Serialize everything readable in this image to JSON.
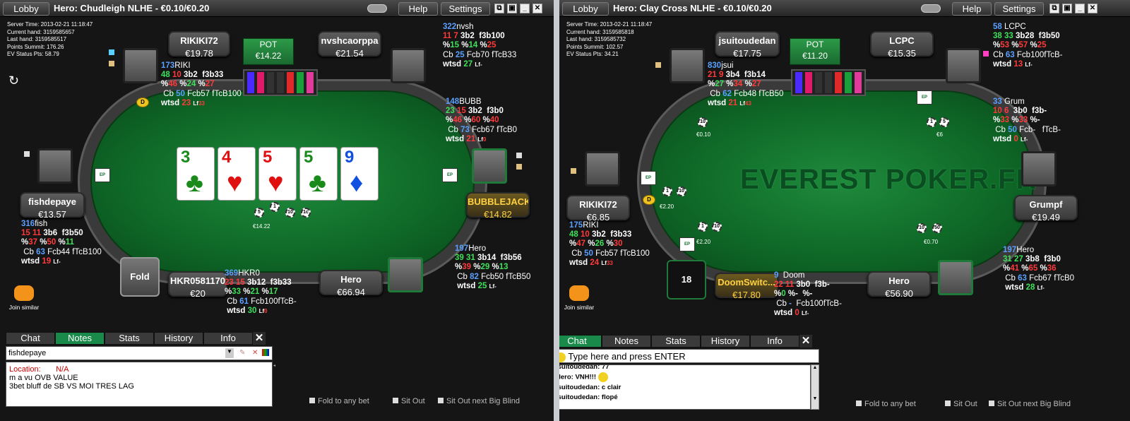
{
  "win1": {
    "lobby": "Lobby",
    "title": "Hero: Chudleigh NLHE - €0.10/€0.20",
    "help": "Help",
    "settings": "Settings",
    "info": [
      "Server Time: 2013-02-21 11:18:47",
      "Current hand: 3159585657",
      "Last hand: 3159585517",
      "Points Summit: 176.26",
      "EV Status Pts: 58.79"
    ],
    "pot_label": "POT",
    "pot": "€14.22",
    "seats": {
      "s1": {
        "name": "RIKIKI72",
        "stack": "€19.78"
      },
      "s2": {
        "name": "nvshcaorppa",
        "stack": "€21.54"
      },
      "s3": {
        "name": "fishdepaye",
        "stack": "€13.57"
      },
      "s4": {
        "name": "BUBBLEJACK",
        "stack": "€14.82"
      },
      "s5": {
        "name": "HKR0581170",
        "stack": "€20"
      },
      "s6": {
        "name": "Hero",
        "stack": "€66.94"
      }
    },
    "hud": {
      "h1": {
        "a": "173",
        "b": "RIKI",
        "l2": [
          "48",
          "10",
          "3b2",
          "f3b33"
        ],
        "l3": [
          "%",
          "46",
          "%",
          "24",
          "%",
          "27"
        ],
        "l4": [
          "Cb",
          "50",
          "Fcb57 fTcB100"
        ],
        "l5": [
          "wtsd",
          "23",
          "Lf",
          "33"
        ]
      },
      "h2": {
        "a": "322",
        "b": "nvsh",
        "l2": [
          "11",
          "7",
          "3b2",
          "f3b100"
        ],
        "l3": [
          "%",
          "15",
          "%",
          "14",
          "%",
          "25"
        ],
        "l4": [
          "Cb",
          "25",
          "Fcb70 fTcB33"
        ],
        "l5": [
          "wtsd",
          "27",
          "Lf",
          "-"
        ]
      },
      "h3": {
        "a": "148",
        "b": "BUBB",
        "l2": [
          "23",
          "15",
          "3b2",
          "f3b0"
        ],
        "l3": [
          "%",
          "46",
          "%",
          "60",
          "%",
          "40"
        ],
        "l4": [
          "Cb",
          "73",
          "Fcb67 fTcB0"
        ],
        "l5": [
          "wtsd",
          "21",
          "Lf",
          "0"
        ]
      },
      "h4": {
        "a": "316",
        "b": "fish",
        "l2": [
          "15",
          "11",
          "3b6",
          "f3b50"
        ],
        "l3": [
          "%",
          "37",
          "%",
          "50",
          "%",
          "11"
        ],
        "l4": [
          "Cb",
          "63",
          "Fcb44 fTcB100"
        ],
        "l5": [
          "wtsd",
          "19",
          "Lf",
          "-"
        ]
      },
      "h5": {
        "a": "369",
        "b": "HKR0",
        "l2": [
          "23",
          "15",
          "3b12",
          "f3b33"
        ],
        "l3": [
          "%",
          "33",
          "%",
          "21",
          "%",
          "17"
        ],
        "l4": [
          "Cb",
          "61",
          "Fcb100fTcB-"
        ],
        "l5": [
          "wtsd",
          "30",
          "Lf",
          "0"
        ]
      },
      "h6": {
        "a": "197",
        "b": "Hero",
        "l2": [
          "39",
          "31",
          "3b14",
          "f3b56"
        ],
        "l3": [
          "%",
          "39",
          "%",
          "29",
          "%",
          "13"
        ],
        "l4": [
          "Cb",
          "82",
          "Fcb50 fTcB50"
        ],
        "l5": [
          "wtsd",
          "25",
          "Lf",
          "-"
        ]
      }
    },
    "board": [
      {
        "r": "3",
        "s": "♣",
        "c": "blk"
      },
      {
        "r": "4",
        "s": "♥",
        "c": "red"
      },
      {
        "r": "5",
        "s": "♥",
        "c": "red"
      },
      {
        "r": "5",
        "s": "♣",
        "c": "blk"
      },
      {
        "r": "9",
        "s": "♦",
        "c": "blu"
      }
    ],
    "chips": [
      "5",
      "1",
      "10",
      "1c"
    ],
    "chip_total": "€14.22",
    "fold": "Fold",
    "join": "Join similar",
    "tabs": [
      "Chat",
      "Notes",
      "Stats",
      "History",
      "Info"
    ],
    "close": "✕",
    "notes_player": "fishdepaye",
    "notes": {
      "loc_label": "Location:",
      "loc_val": "N/A",
      "line1": "m a vu OVB VALUE",
      "line2": "3bet bluff de SB VS MOI TRES LAG"
    },
    "opts": [
      "Fold to any bet",
      "Sit Out",
      "Sit Out next Big Blind"
    ]
  },
  "win2": {
    "lobby": "Lobby",
    "title": "Hero: Clay Cross NLHE - €0.10/€0.20",
    "help": "Help",
    "settings": "Settings",
    "info": [
      "Server Time: 2013-02-21 11:18:47",
      "Current hand: 3159585818",
      "Last hand: 3159585732",
      "Points Summit: 102.57",
      "EV Status Pts: 34.21"
    ],
    "pot_label": "POT",
    "pot": "€11.20",
    "seats": {
      "s1": {
        "name": "jsuitoudedan",
        "stack": "€17.75"
      },
      "s2": {
        "name": "LCPC",
        "stack": "€15.35"
      },
      "s3": {
        "name": "RIKIKI72",
        "stack": "€6.85"
      },
      "s4": {
        "name": "Grumpf",
        "stack": "€19.49"
      },
      "s5": {
        "name": "DoomSwitc...",
        "stack": "€17.80"
      },
      "s6": {
        "name": "Hero",
        "stack": "€56.90"
      }
    },
    "hud": {
      "h1": {
        "a": "830",
        "b": "jsui",
        "l2": [
          "21",
          "9",
          "3b4",
          "f3b14"
        ],
        "l3": [
          "%",
          "27",
          "%",
          "34",
          "%",
          "27"
        ],
        "l4": [
          "Cb",
          "62",
          "Fcb48 fTcB50"
        ],
        "l5": [
          "wtsd",
          "21",
          "Lf",
          "43"
        ]
      },
      "h2": {
        "a": "58",
        "b": "LCPC",
        "l2": [
          "38",
          "33",
          "3b28",
          "f3b50"
        ],
        "l3": [
          "%",
          "53",
          "%",
          "57",
          "%",
          "25"
        ],
        "l4": [
          "Cb",
          "63",
          "Fcb100fTcB-"
        ],
        "l5": [
          "wtsd",
          "13",
          "Lf",
          "-"
        ]
      },
      "h3": {
        "a": "33",
        "b": "Grum",
        "l2": [
          "10",
          "6",
          "3b0",
          "f3b-"
        ],
        "l3": [
          "%",
          "33",
          "%",
          "33",
          "%",
          "-"
        ],
        "l4": [
          "Cb",
          "50",
          "Fcb-",
          "fTcB-"
        ],
        "l5": [
          "wtsd",
          "0",
          "Lf",
          "-"
        ]
      },
      "h4": {
        "a": "175",
        "b": "RIKI",
        "l2": [
          "48",
          "10",
          "3b2",
          "f3b33"
        ],
        "l3": [
          "%",
          "47",
          "%",
          "26",
          "%",
          "30"
        ],
        "l4": [
          "Cb",
          "50",
          "Fcb57 fTcB100"
        ],
        "l5": [
          "wtsd",
          "24",
          "Lf",
          "33"
        ]
      },
      "h5": {
        "a": "9",
        "b": "Doom",
        "l2": [
          "22",
          "11",
          "3b0",
          "f3b-"
        ],
        "l3": [
          "%",
          "0",
          "%",
          "-",
          "%",
          "-"
        ],
        "l4": [
          "Cb",
          "-",
          "Fcb100fTcB-"
        ],
        "l5": [
          "wtsd",
          "0",
          "Lf",
          "-"
        ]
      },
      "h6": {
        "a": "197",
        "b": "Hero",
        "l2": [
          "31",
          "27",
          "3b8",
          "f3b0"
        ],
        "l3": [
          "%",
          "41",
          "%",
          "65",
          "%",
          "36"
        ],
        "l4": [
          "Cb",
          "63",
          "Fcb67 fTcB0"
        ],
        "l5": [
          "wtsd",
          "28",
          "Lf",
          "-"
        ]
      }
    },
    "logo": "EVEREST POKER.FR",
    "bets": [
      {
        "chips": [
          "10"
        ],
        "amt": "€0.10"
      },
      {
        "chips": [
          "1",
          "5"
        ],
        "amt": "€6"
      },
      {
        "chips": [
          "1",
          "10"
        ],
        "amt": "€2.20"
      },
      {
        "chips": [
          "1",
          "10"
        ],
        "amt": "€2.20"
      },
      {
        "chips": [
          "10",
          "50"
        ],
        "amt": "€0.70"
      }
    ],
    "timer": "18",
    "join": "Join similar",
    "tabs": [
      "Chat",
      "Notes",
      "Stats",
      "History",
      "Info"
    ],
    "close": "✕",
    "chat_input": "Type here and press ENTER",
    "chat": [
      "jsuitoudedan: 77",
      "Hero: VNH!!!",
      "jsuitoudedan: c clair",
      "jsuitoudedan: flopé"
    ],
    "opts": [
      "Fold to any bet",
      "Sit Out",
      "Sit Out next Big Blind"
    ]
  },
  "colors": {
    "felt": "#1a7a35",
    "active": "#ffd040",
    "tab_on": "#1a8a4a",
    "hud_blue": "#5aa0ff",
    "hud_green": "#3fe05a",
    "hud_red": "#ff3a3a"
  }
}
